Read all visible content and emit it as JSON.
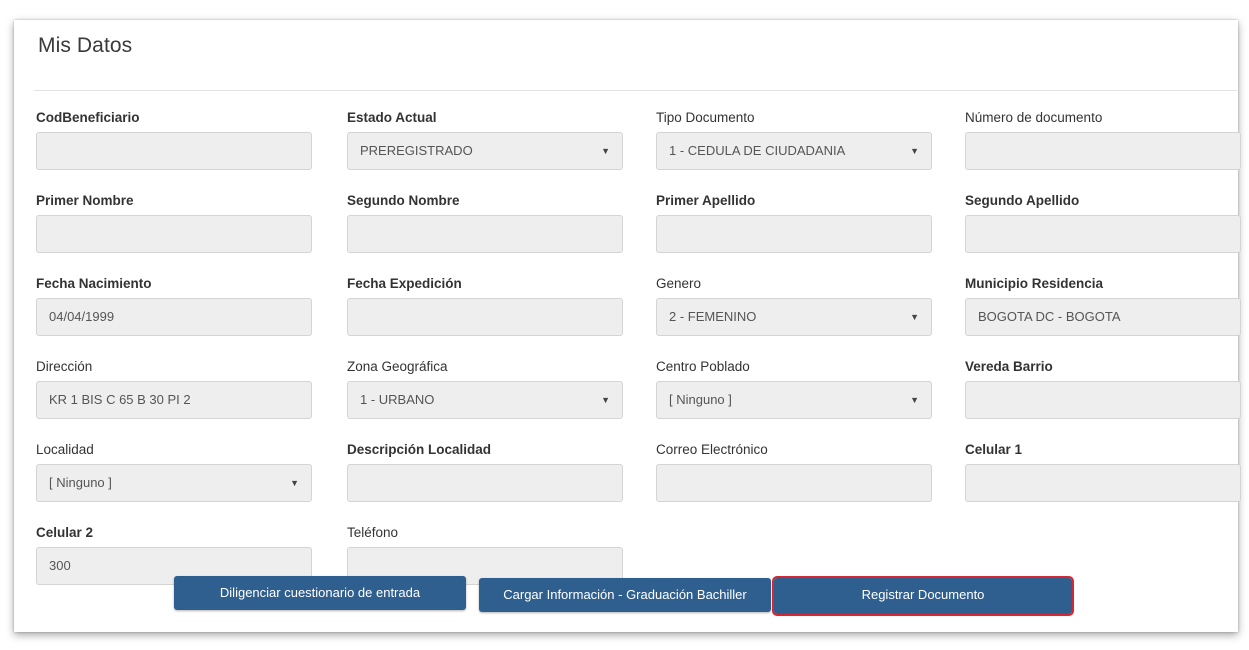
{
  "panel": {
    "title": "Mis Datos"
  },
  "rows": [
    [
      {
        "label": "CodBeneficiario",
        "bold": true,
        "type": "input",
        "value": ""
      },
      {
        "label": "Estado Actual",
        "bold": true,
        "type": "select",
        "value": "PREREGISTRADO"
      },
      {
        "label": "Tipo Documento",
        "bold": false,
        "type": "select",
        "value": "1 - CEDULA DE CIUDADANIA"
      },
      {
        "label": "Número de documento",
        "bold": false,
        "type": "input",
        "value": ""
      }
    ],
    [
      {
        "label": "Primer Nombre",
        "bold": true,
        "type": "input",
        "value": ""
      },
      {
        "label": "Segundo Nombre",
        "bold": true,
        "type": "input",
        "value": ""
      },
      {
        "label": "Primer Apellido",
        "bold": true,
        "type": "input",
        "value": ""
      },
      {
        "label": "Segundo Apellido",
        "bold": true,
        "type": "input",
        "value": ""
      }
    ],
    [
      {
        "label": "Fecha Nacimiento",
        "bold": true,
        "type": "input",
        "value": "04/04/1999"
      },
      {
        "label": "Fecha Expedición",
        "bold": true,
        "type": "input",
        "value": ""
      },
      {
        "label": "Genero",
        "bold": false,
        "type": "select",
        "value": "2 - FEMENINO"
      },
      {
        "label": "Municipio Residencia",
        "bold": true,
        "type": "input",
        "value": "BOGOTA DC - BOGOTA"
      }
    ],
    [
      {
        "label": "Dirección",
        "bold": false,
        "type": "input",
        "value": "KR 1 BIS C 65 B 30 PI 2"
      },
      {
        "label": "Zona Geográfica",
        "bold": false,
        "type": "select",
        "value": "1 - URBANO"
      },
      {
        "label": "Centro Poblado",
        "bold": false,
        "type": "select",
        "value": "[ Ninguno ]"
      },
      {
        "label": "Vereda Barrio",
        "bold": true,
        "type": "input",
        "value": ""
      }
    ],
    [
      {
        "label": "Localidad",
        "bold": false,
        "type": "select",
        "value": "[ Ninguno ]"
      },
      {
        "label": "Descripción Localidad",
        "bold": true,
        "type": "input",
        "value": ""
      },
      {
        "label": "Correo Electrónico",
        "bold": false,
        "type": "input",
        "value": ""
      },
      {
        "label": "Celular 1",
        "bold": true,
        "type": "input",
        "value": ""
      }
    ],
    [
      {
        "label": "Celular 2",
        "bold": true,
        "type": "input",
        "value": "300"
      },
      {
        "label": "Teléfono",
        "bold": false,
        "type": "input",
        "value": ""
      }
    ]
  ],
  "buttons": {
    "questionnaire": "Diligenciar cuestionario de entrada",
    "upload": "Cargar Información - Graduación Bachiller",
    "register": "Registrar Documento"
  },
  "caret_glyph": "▼",
  "colors": {
    "button_bg": "#2f5f8f",
    "highlight_border": "#d62832",
    "field_bg": "#eeeeee"
  }
}
